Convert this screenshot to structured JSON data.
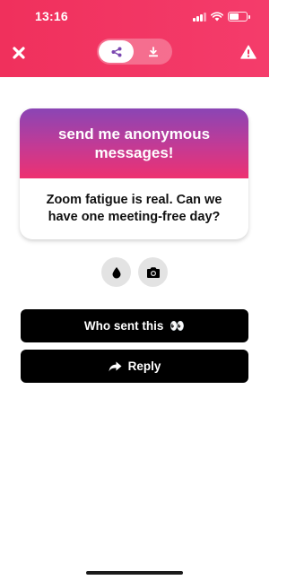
{
  "status_bar": {
    "time": "13:16"
  },
  "header": {
    "close_icon": "close-icon",
    "share_icon": "share-icon",
    "download_icon": "download-icon",
    "warning_icon": "warning-icon",
    "accent": "#f0305c"
  },
  "card": {
    "prompt": "send me anonymous messages!",
    "message": "Zoom fatigue is real. Can we have one meeting-free day?"
  },
  "tools": [
    {
      "icon": "water-drop-icon"
    },
    {
      "icon": "camera-icon"
    }
  ],
  "actions": {
    "who_sent": {
      "label": "Who sent this",
      "emoji": "👀"
    },
    "reply": {
      "label": "Reply"
    }
  }
}
